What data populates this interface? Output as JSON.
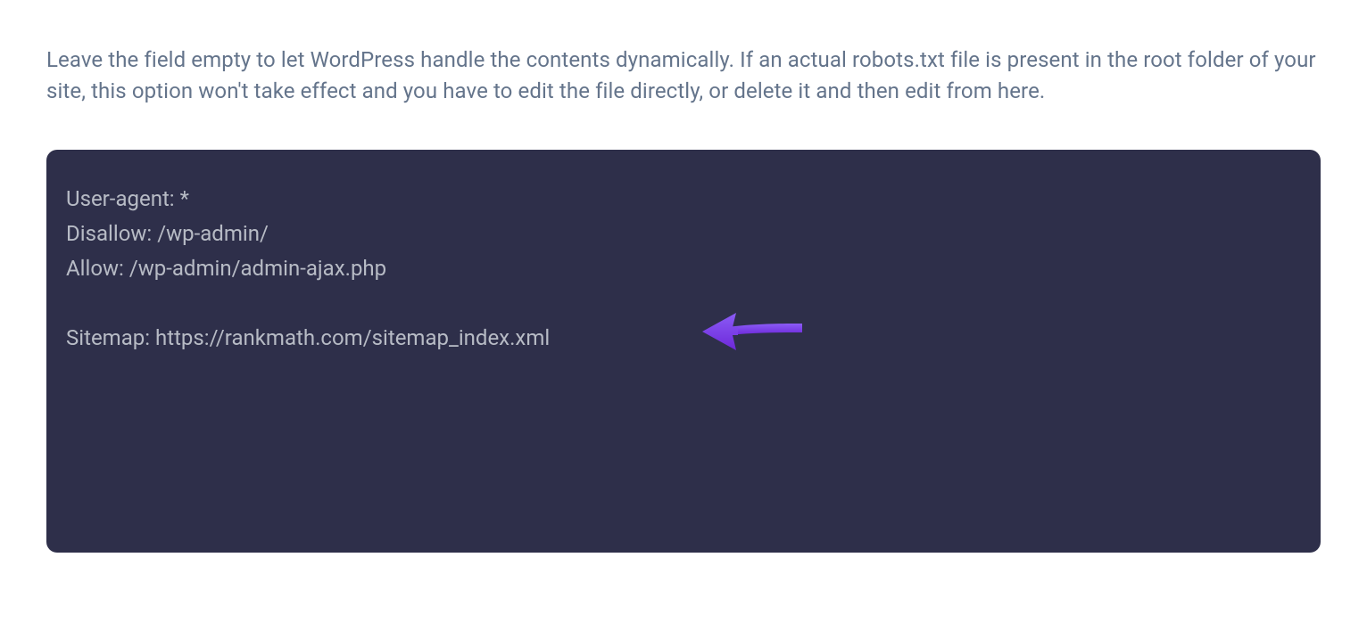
{
  "description": "Leave the field empty to let WordPress handle the contents dynamically. If an actual robots.txt file is present in the root folder of your site, this option won't take effect and you have to edit the file directly, or delete it and then edit from here.",
  "editor": {
    "lines": [
      "User-agent: *",
      "Disallow: /wp-admin/",
      "Allow: /wp-admin/admin-ajax.php",
      "",
      "Sitemap: https://rankmath.com/sitemap_index.xml"
    ]
  },
  "annotation": {
    "arrow_color": "#7c3aed"
  }
}
